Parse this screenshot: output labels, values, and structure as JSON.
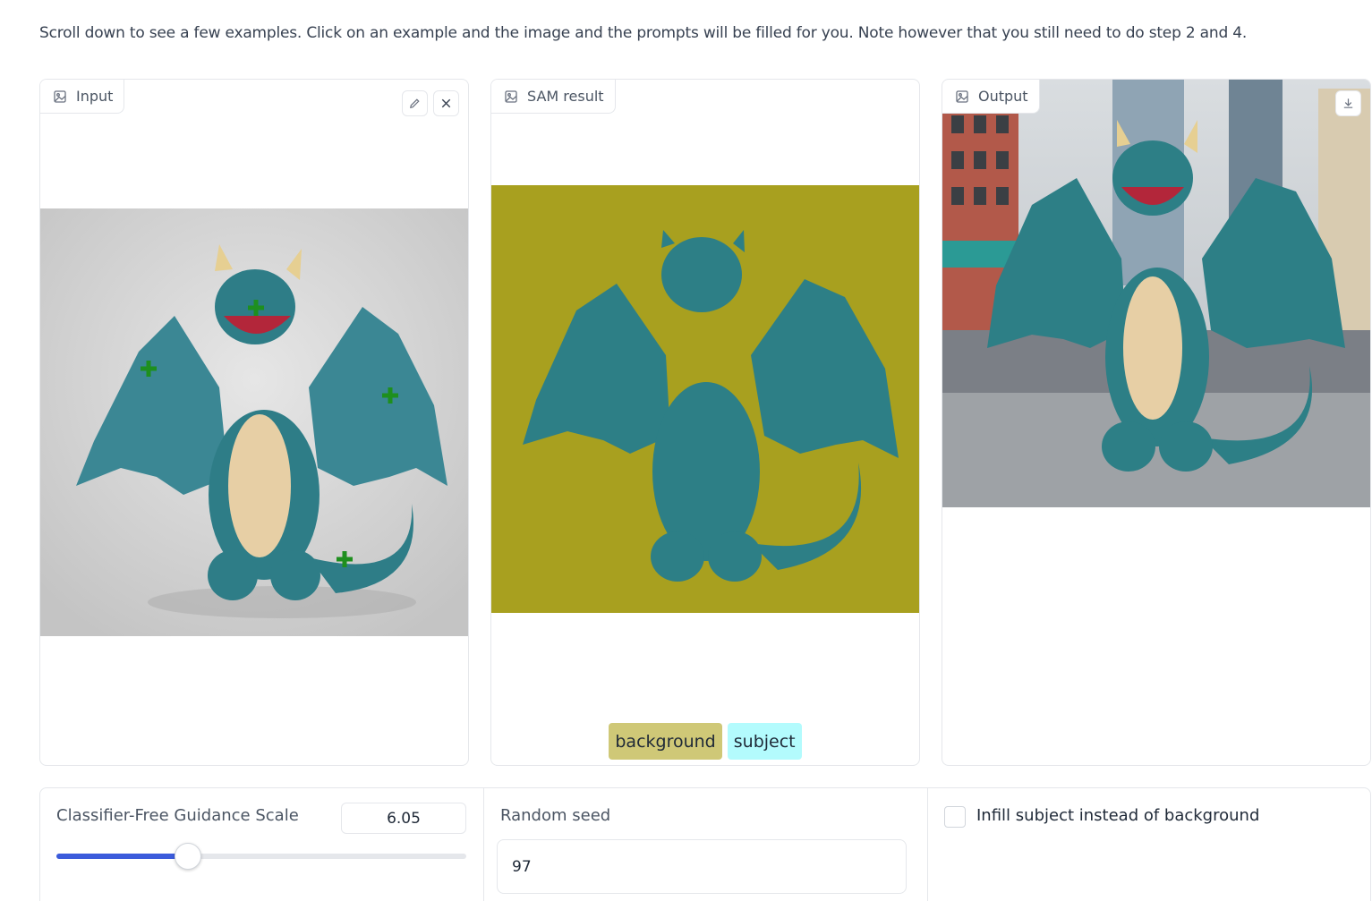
{
  "intro_text": "Scroll down to see a few examples. Click on an example and the image and the prompts will be filled for you. Note however that you still need to do step 2 and 4.",
  "panels": {
    "input": {
      "label": "Input",
      "icon": "image-icon",
      "tools": [
        "edit-icon",
        "close-icon"
      ]
    },
    "sam": {
      "label": "SAM result",
      "icon": "image-icon",
      "legend": [
        {
          "label": "background",
          "color": "#cfc877"
        },
        {
          "label": "subject",
          "color": "#b3fbfd"
        }
      ]
    },
    "output": {
      "label": "Output",
      "icon": "image-icon",
      "tools": [
        "download-icon"
      ]
    }
  },
  "controls": {
    "guidance": {
      "label": "Classifier-Free Guidance Scale",
      "value": "6.05",
      "fraction": 0.32
    },
    "seed": {
      "label": "Random seed",
      "value": "97"
    },
    "infill": {
      "label": "Infill subject instead of background",
      "checked": false
    }
  },
  "colors": {
    "sam_background": "#a8a01f",
    "dragon": "#2d7f86",
    "slider": "#3b5bdb"
  }
}
